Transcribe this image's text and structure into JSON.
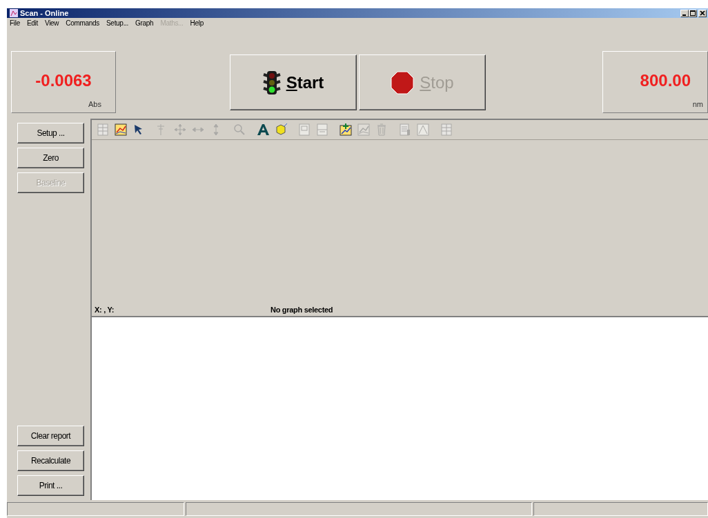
{
  "window": {
    "title": "Scan - Online"
  },
  "menu": [
    {
      "label": "File",
      "disabled": false
    },
    {
      "label": "Edit",
      "disabled": false
    },
    {
      "label": "View",
      "disabled": false
    },
    {
      "label": "Commands",
      "disabled": false
    },
    {
      "label": "Setup...",
      "disabled": false
    },
    {
      "label": "Graph",
      "disabled": false
    },
    {
      "label": "Maths...",
      "disabled": true
    },
    {
      "label": "Help",
      "disabled": false
    }
  ],
  "readouts": [
    {
      "value": "-0.0063",
      "unit": "Abs"
    },
    {
      "value": "800.00",
      "unit": "nm"
    }
  ],
  "run_buttons": [
    {
      "kind": "start",
      "label": "Start",
      "mnemonic": true,
      "disabled": false
    },
    {
      "kind": "stop",
      "label": "Stop",
      "mnemonic": true,
      "disabled": true
    }
  ],
  "side_buttons_top": [
    {
      "label": "Setup ...",
      "disabled": false
    },
    {
      "label": "Zero",
      "disabled": false
    },
    {
      "label": "Baseline",
      "disabled": true
    }
  ],
  "side_buttons_bottom": [
    {
      "label": "Clear report",
      "disabled": false
    },
    {
      "label": "Recalculate",
      "disabled": false
    },
    {
      "label": "Print ...",
      "disabled": false
    }
  ],
  "toolbar_groups": [
    [
      {
        "kind": "table",
        "disabled": true
      },
      {
        "kind": "graph",
        "disabled": false
      },
      {
        "kind": "pointer",
        "disabled": false
      }
    ],
    [
      {
        "kind": "axis",
        "disabled": true
      },
      {
        "kind": "move",
        "disabled": true
      },
      {
        "kind": "hresize",
        "disabled": true
      },
      {
        "kind": "vresize",
        "disabled": true
      }
    ],
    [
      {
        "kind": "zoom",
        "disabled": true
      }
    ],
    [
      {
        "kind": "text",
        "disabled": false
      },
      {
        "kind": "shape",
        "disabled": false
      }
    ],
    [
      {
        "kind": "page",
        "disabled": true
      },
      {
        "kind": "split",
        "disabled": true
      }
    ],
    [
      {
        "kind": "addgraph",
        "disabled": false
      },
      {
        "kind": "graph",
        "disabled": true
      },
      {
        "kind": "trash",
        "disabled": true
      }
    ],
    [
      {
        "kind": "doc",
        "disabled": true
      },
      {
        "kind": "chartbox",
        "disabled": true
      }
    ],
    [
      {
        "kind": "table",
        "disabled": true
      }
    ]
  ],
  "graph_area": {
    "coordinates": "X: , Y:",
    "status": "No graph selected"
  }
}
